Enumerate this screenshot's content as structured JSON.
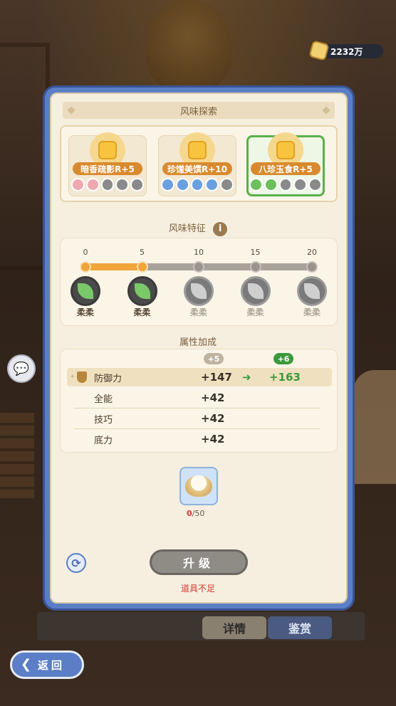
{
  "currency": {
    "amount": "2232万",
    "icon": "coin-icon"
  },
  "panel": {
    "title": "风味探索",
    "recipes": [
      {
        "name": "暗香疏影R+5",
        "color": "#d98a2e",
        "badge_color": "#f0a8b0",
        "badges": 5,
        "filled": 2,
        "selected": false
      },
      {
        "name": "珍馐美馔R+10",
        "color": "#d98a2e",
        "badge_color": "#6aa0e0",
        "badges": 5,
        "filled": 4,
        "selected": false
      },
      {
        "name": "八珍玉食R+5",
        "color": "#d98a2e",
        "badge_color": "#6cbf5a",
        "badges": 5,
        "filled": 2,
        "selected": true
      }
    ],
    "traits_title": "风味特征",
    "info_label": "i",
    "ticks": [
      "0",
      "5",
      "10",
      "15",
      "20"
    ],
    "progress_value": 5,
    "progress_max": 20,
    "trait_labels": [
      "柔柔",
      "柔柔",
      "柔柔",
      "柔柔",
      "柔柔"
    ],
    "attr_title": "属性加成",
    "current_level": "+5",
    "next_level": "+6",
    "attributes": [
      {
        "name": "防御力",
        "value": "+147",
        "next": "+163"
      },
      {
        "name": "全能",
        "value": "+42"
      },
      {
        "name": "技巧",
        "value": "+42"
      },
      {
        "name": "底力",
        "value": "+42"
      }
    ],
    "item": {
      "have": "0",
      "need": "/50",
      "icon": "rice-bowl-icon"
    },
    "upgrade_label": "升级",
    "warning": "道具不足"
  },
  "tabs": {
    "detail": "详情",
    "appreciate": "鉴赏"
  },
  "back_label": "返回",
  "arrow_symbol": "➜",
  "colors": {
    "accent_blue": "#5b7ec6",
    "progress_orange": "#f0a43a",
    "green": "#3a9a3a",
    "warn_red": "#d03a2a"
  }
}
